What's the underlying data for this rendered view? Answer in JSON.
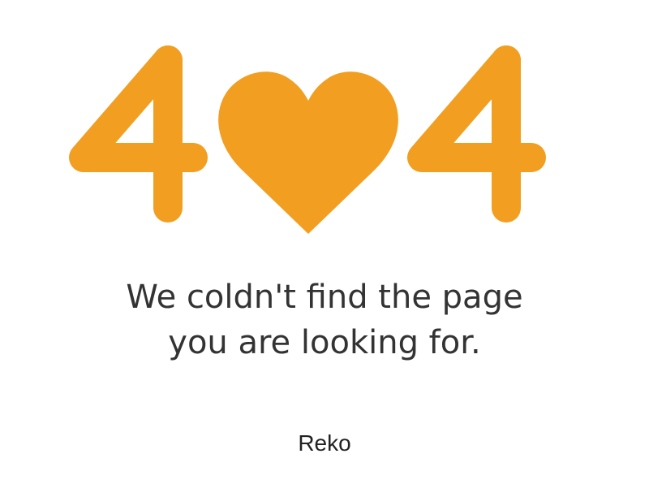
{
  "hero": {
    "code_text": "404",
    "digit_left": "4",
    "digit_right": "4",
    "accent_color": "#F29E21",
    "heart_icon": "heart-icon"
  },
  "message": {
    "line1": "We coldn't find the page",
    "line2": "you are looking for."
  },
  "brand": {
    "name": "Reko"
  },
  "colors": {
    "background": "#FFFFFF",
    "text": "#333333",
    "accent": "#F29E21"
  }
}
